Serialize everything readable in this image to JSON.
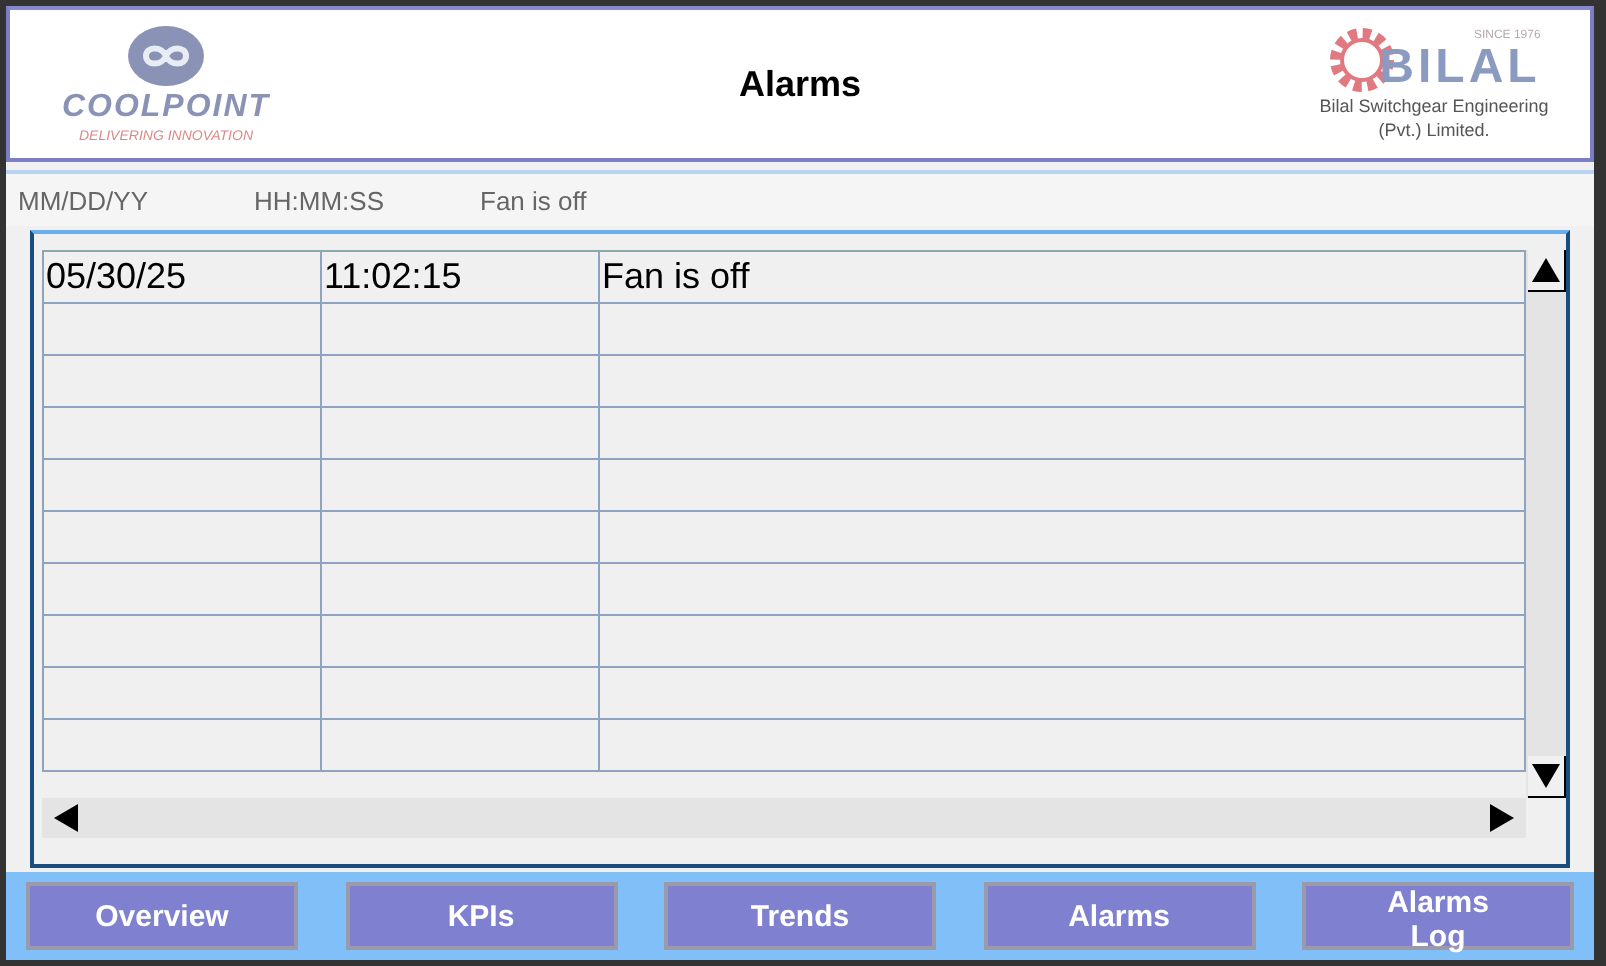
{
  "header": {
    "left_logo": {
      "name": "COOLPOINT",
      "tagline": "DELIVERING INNOVATION"
    },
    "title": "Alarms",
    "right_logo": {
      "since": "SINCE 1976",
      "name": "BILAL",
      "company": "Bilal Switchgear Engineering",
      "company_suffix": "(Pvt.) Limited."
    }
  },
  "table": {
    "columns": [
      "MM/DD/YY",
      "HH:MM:SS",
      "Fan is off"
    ],
    "rows": [
      [
        "05/30/25",
        "11:02:15",
        "Fan is off"
      ]
    ]
  },
  "nav": [
    {
      "label": "Overview"
    },
    {
      "label": "KPIs"
    },
    {
      "label": "Trends"
    },
    {
      "label": "Alarms"
    },
    {
      "label": "Alarms Log"
    }
  ]
}
